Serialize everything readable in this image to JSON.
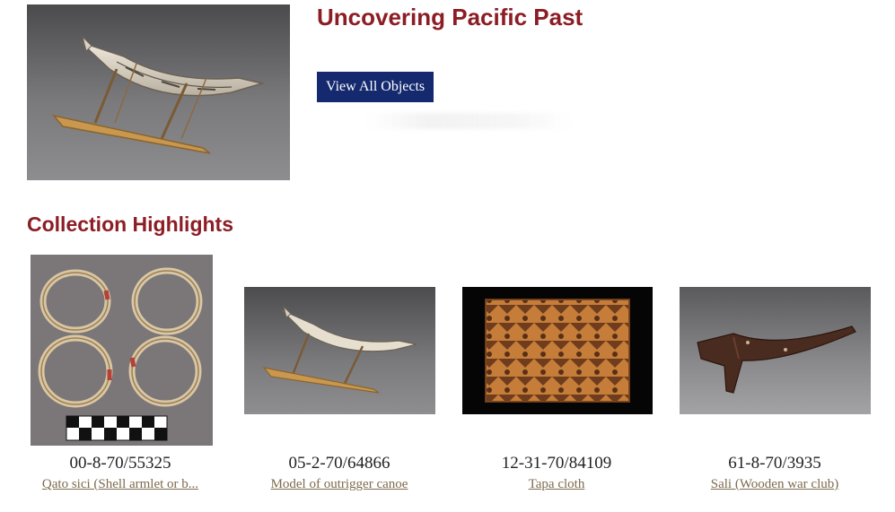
{
  "hero": {
    "title": "Uncovering Pacific Past",
    "button_label": "View All Objects",
    "image_alt": "Model of outrigger canoe"
  },
  "highlights": {
    "title": "Collection Highlights",
    "items": [
      {
        "number": "00-8-70/55325",
        "title": "Qato sici (Shell armlet or b...",
        "image_subject": "shell armlets with scale bar"
      },
      {
        "number": "05-2-70/64866",
        "title": "Model of outrigger canoe",
        "image_subject": "outrigger canoe model"
      },
      {
        "number": "12-31-70/84109",
        "title": "Tapa cloth",
        "image_subject": "patterned bark cloth"
      },
      {
        "number": "61-8-70/3935",
        "title": "Sali (Wooden war club)",
        "image_subject": "wooden war club"
      }
    ]
  },
  "colors": {
    "heading": "#8c1d24",
    "button_bg": "#14296e",
    "link": "#7d6a4e"
  }
}
